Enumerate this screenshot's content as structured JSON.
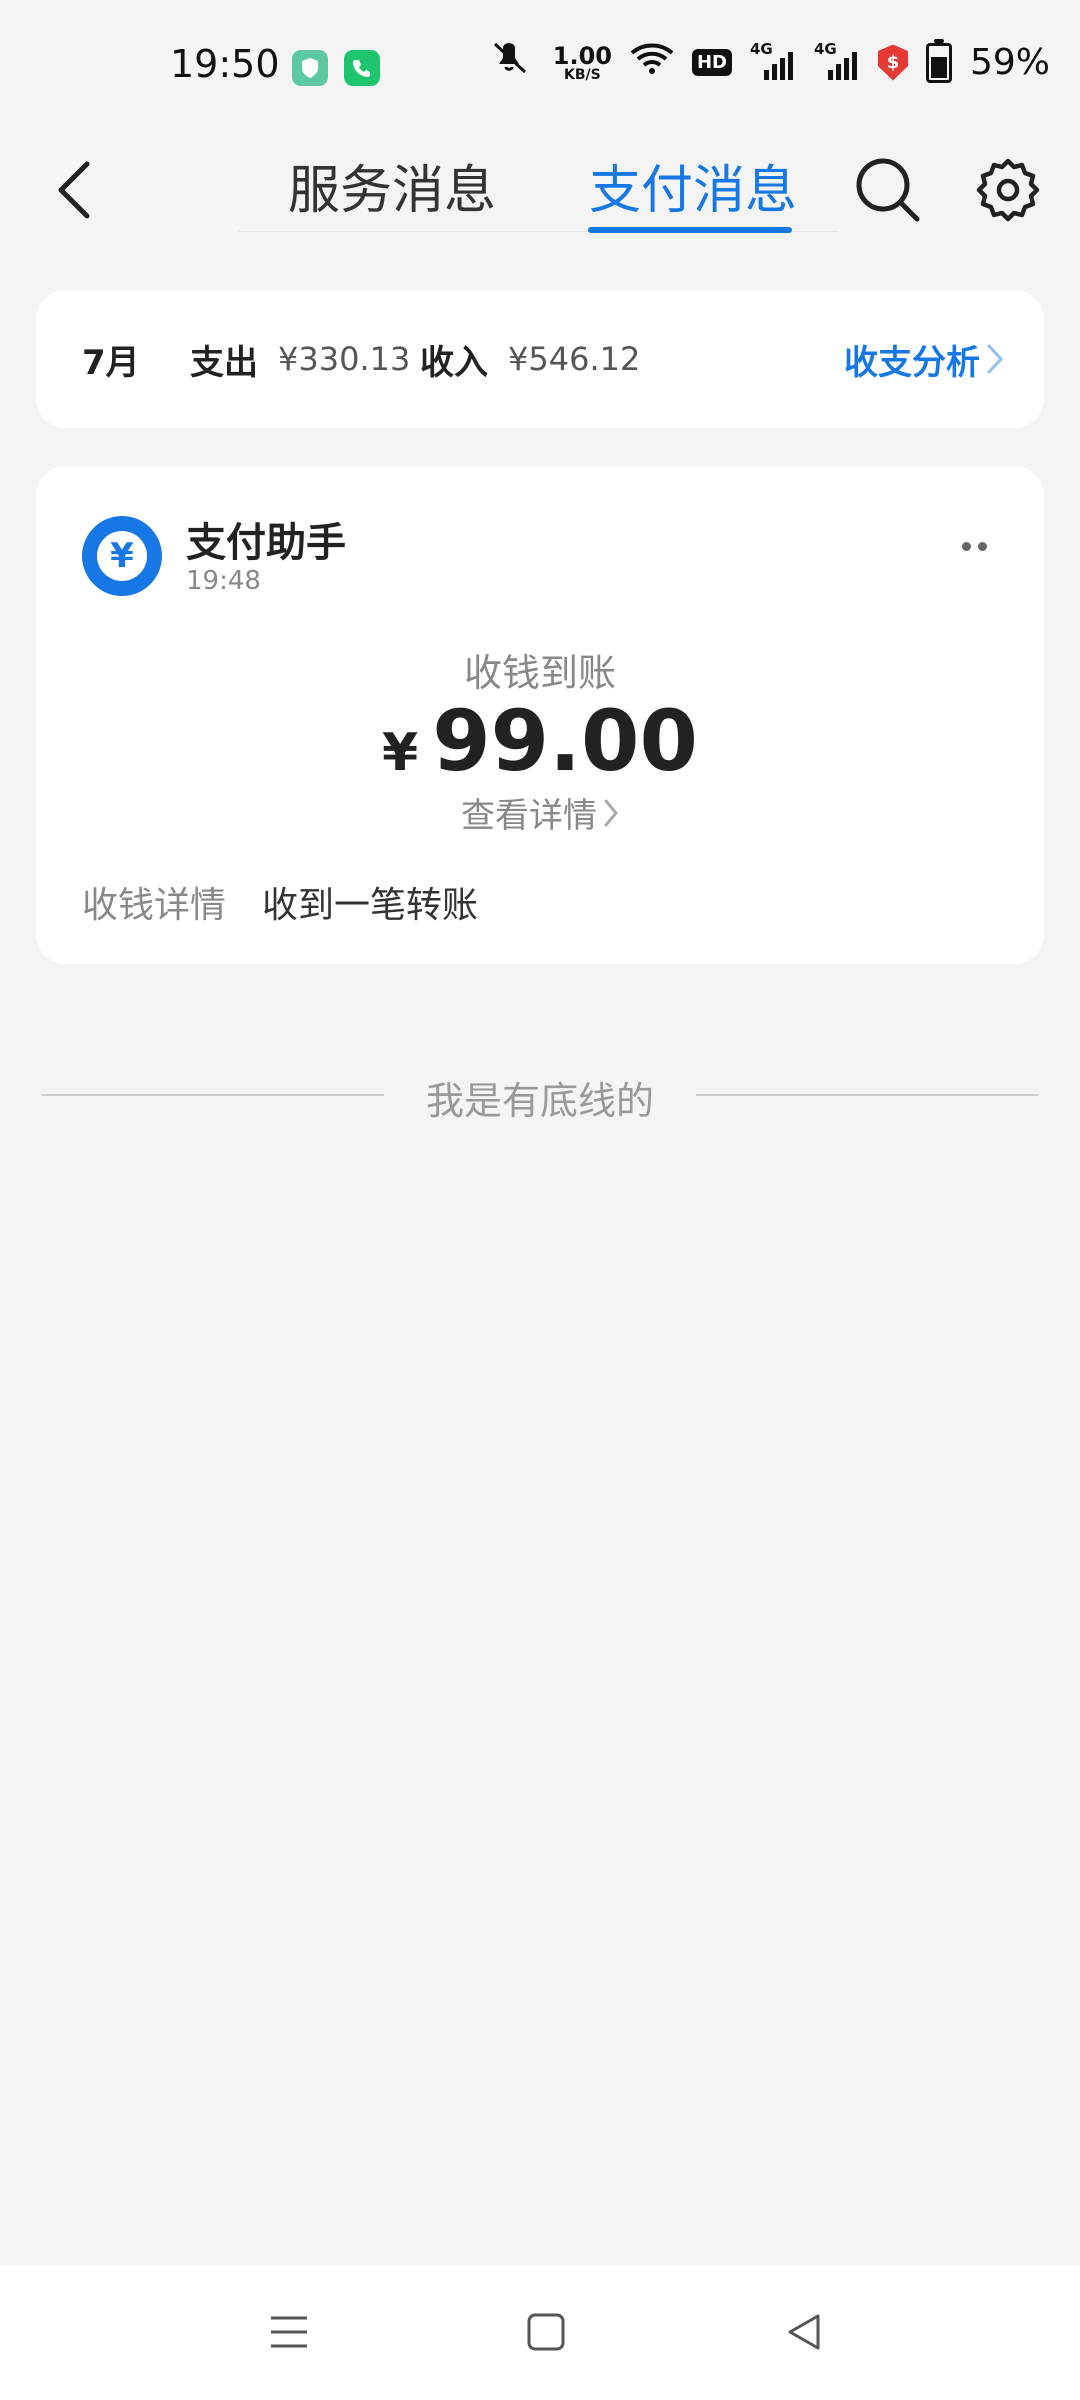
{
  "status_bar": {
    "time": "19:50",
    "net_speed_value": "1.00",
    "net_speed_unit": "KB/S",
    "hd_badge": "HD",
    "network_label_1": "4G",
    "network_label_2": "4G",
    "shield_symbol": "$",
    "battery_percent": "59%",
    "battery_level": 0.59,
    "icons": [
      "shield-app-icon",
      "phone-app-icon",
      "mute-icon",
      "wifi-icon",
      "signal-icon",
      "security-shield-icon",
      "battery-icon"
    ]
  },
  "header": {
    "tabs": [
      {
        "label": "服务消息",
        "active": false
      },
      {
        "label": "支付消息",
        "active": true
      }
    ],
    "accent_color": "#1677e5"
  },
  "summary": {
    "month": "7月",
    "expense_label": "支出",
    "expense_amount": "¥330.13",
    "income_label": "收入",
    "income_amount": "¥546.12",
    "analysis_link": "收支分析"
  },
  "message": {
    "sender": "支付助手",
    "time": "19:48",
    "avatar_symbol": "¥",
    "title": "收钱到账",
    "currency": "¥",
    "amount": "99.00",
    "detail_link": "查看详情",
    "row_label": "收钱详情",
    "row_value": "收到一笔转账"
  },
  "footer": {
    "bottom_text": "我是有底线的"
  }
}
